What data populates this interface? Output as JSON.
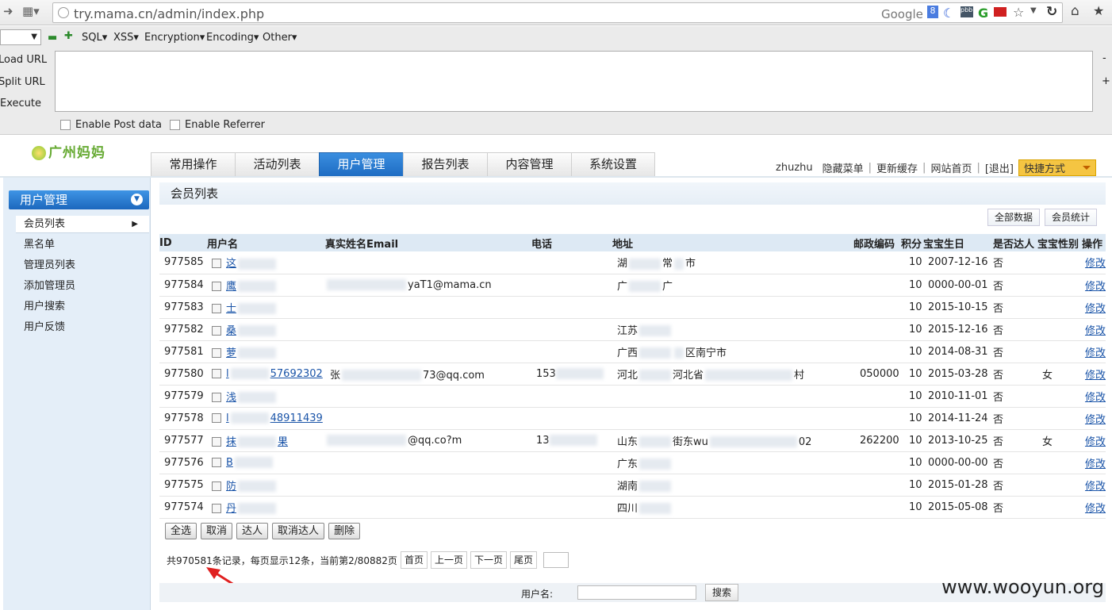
{
  "browser": {
    "url": "try.mama.cn/admin/index.php",
    "search_engine": "Google"
  },
  "hackbar": {
    "menus": [
      "SQL",
      "XSS",
      "Encryption",
      "Encoding",
      "Other"
    ],
    "side": [
      "Load URL",
      "Split URL",
      "Execute"
    ],
    "post_label": "Enable Post data",
    "referrer_label": "Enable Referrer"
  },
  "site": {
    "logo": "广州妈妈",
    "nav": [
      "常用操作",
      "活动列表",
      "用户管理",
      "报告列表",
      "内容管理",
      "系统设置"
    ],
    "nav_active": 2,
    "user": "zhuzhu",
    "links": [
      "隐藏菜单",
      "更新缓存",
      "网站首页",
      "[退出]"
    ],
    "quick": "快捷方式"
  },
  "sidebar": {
    "title": "用户管理",
    "items": [
      "会员列表",
      "黑名单",
      "管理员列表",
      "添加管理员",
      "用户搜索",
      "用户反馈"
    ]
  },
  "main": {
    "title": "会员列表",
    "btn_all": "全部数据",
    "btn_stats": "会员统计",
    "columns": [
      "ID",
      "用户名",
      "真实姓名Email",
      "电话",
      "地址",
      "邮政编码",
      "积分",
      "宝宝生日",
      "是否达人",
      "宝宝性别",
      "操作"
    ],
    "rows": [
      {
        "id": "977585",
        "user": "这",
        "email": "",
        "phone": "",
        "addr": "湖",
        "addr2": "常",
        "addr3": "市",
        "zip": "",
        "points": "10",
        "bday": "2007-12-16",
        "daren": "否",
        "gender": "",
        "op": "修改"
      },
      {
        "id": "977584",
        "user": "鹰",
        "email": "yaT1@mama.cn",
        "phone": "",
        "addr": "广",
        "addr2": "广",
        "addr3": "",
        "zip": "",
        "points": "10",
        "bday": "0000-00-01",
        "daren": "否",
        "gender": "",
        "op": "修改"
      },
      {
        "id": "977583",
        "user": "士",
        "email": "",
        "phone": "",
        "addr": "",
        "addr2": "",
        "addr3": "",
        "zip": "",
        "points": "10",
        "bday": "2015-10-15",
        "daren": "否",
        "gender": "",
        "op": "修改"
      },
      {
        "id": "977582",
        "user": "桑",
        "email": "",
        "phone": "",
        "addr": "江苏",
        "addr2": "",
        "addr3": "",
        "zip": "",
        "points": "10",
        "bday": "2015-12-16",
        "daren": "否",
        "gender": "",
        "op": "修改"
      },
      {
        "id": "977581",
        "user": "萝",
        "email": "",
        "phone": "",
        "addr": "广西",
        "addr2": "",
        "addr3": "区南宁市",
        "zip": "",
        "points": "10",
        "bday": "2014-08-31",
        "daren": "否",
        "gender": "",
        "op": "修改"
      },
      {
        "id": "977580",
        "user": "l",
        "user_tail": "57692302",
        "email": "73@qq.com",
        "email_pre": "张",
        "phone": "153",
        "addr": "河北",
        "addr2": "河北省",
        "addr3": "村",
        "zip": "050000",
        "points": "10",
        "bday": "2015-03-28",
        "daren": "否",
        "gender": "女",
        "op": "修改"
      },
      {
        "id": "977579",
        "user": "浅",
        "email": "",
        "phone": "",
        "addr": "",
        "addr2": "",
        "addr3": "",
        "zip": "",
        "points": "10",
        "bday": "2010-11-01",
        "daren": "否",
        "gender": "",
        "op": "修改"
      },
      {
        "id": "977578",
        "user": "l",
        "user_tail": "48911439",
        "email": "",
        "phone": "",
        "addr": "",
        "addr2": "",
        "addr3": "",
        "zip": "",
        "points": "10",
        "bday": "2014-11-24",
        "daren": "否",
        "gender": "",
        "op": "修改"
      },
      {
        "id": "977577",
        "user": "抹",
        "user_tail": "果",
        "email": "@qq.co?m",
        "phone": "13",
        "addr": "山东",
        "addr2": "街东wu",
        "addr3": "02",
        "zip": "262200",
        "points": "10",
        "bday": "2013-10-25",
        "daren": "否",
        "gender": "女",
        "op": "修改"
      },
      {
        "id": "977576",
        "user": "B",
        "email": "",
        "phone": "",
        "addr": "广东",
        "addr2": "",
        "addr3": "",
        "zip": "",
        "points": "10",
        "bday": "0000-00-00",
        "daren": "否",
        "gender": "",
        "op": "修改"
      },
      {
        "id": "977575",
        "user": "防",
        "email": "",
        "phone": "",
        "addr": "湖南",
        "addr2": "",
        "addr3": "",
        "zip": "",
        "points": "10",
        "bday": "2015-01-28",
        "daren": "否",
        "gender": "",
        "op": "修改"
      },
      {
        "id": "977574",
        "user": "丹",
        "email": "",
        "phone": "",
        "addr": "四川",
        "addr2": "",
        "addr3": "",
        "zip": "",
        "points": "10",
        "bday": "2015-05-08",
        "daren": "否",
        "gender": "",
        "op": "修改"
      }
    ],
    "actions": [
      "全选",
      "取消",
      "达人",
      "取消达人",
      "删除"
    ],
    "pager_text": "共970581条记录，每页显示12条，当前第2/80882页",
    "pager_buttons": [
      "首页",
      "上一页",
      "下一页",
      "尾页"
    ],
    "search_label": "用户名:",
    "search_btn": "搜索"
  },
  "watermark": "www.wooyun.org",
  "colors": {
    "nav_active": "#1e6cc3",
    "link": "#1a54a8",
    "quick": "#f5c542",
    "arrow": "#e02020"
  }
}
